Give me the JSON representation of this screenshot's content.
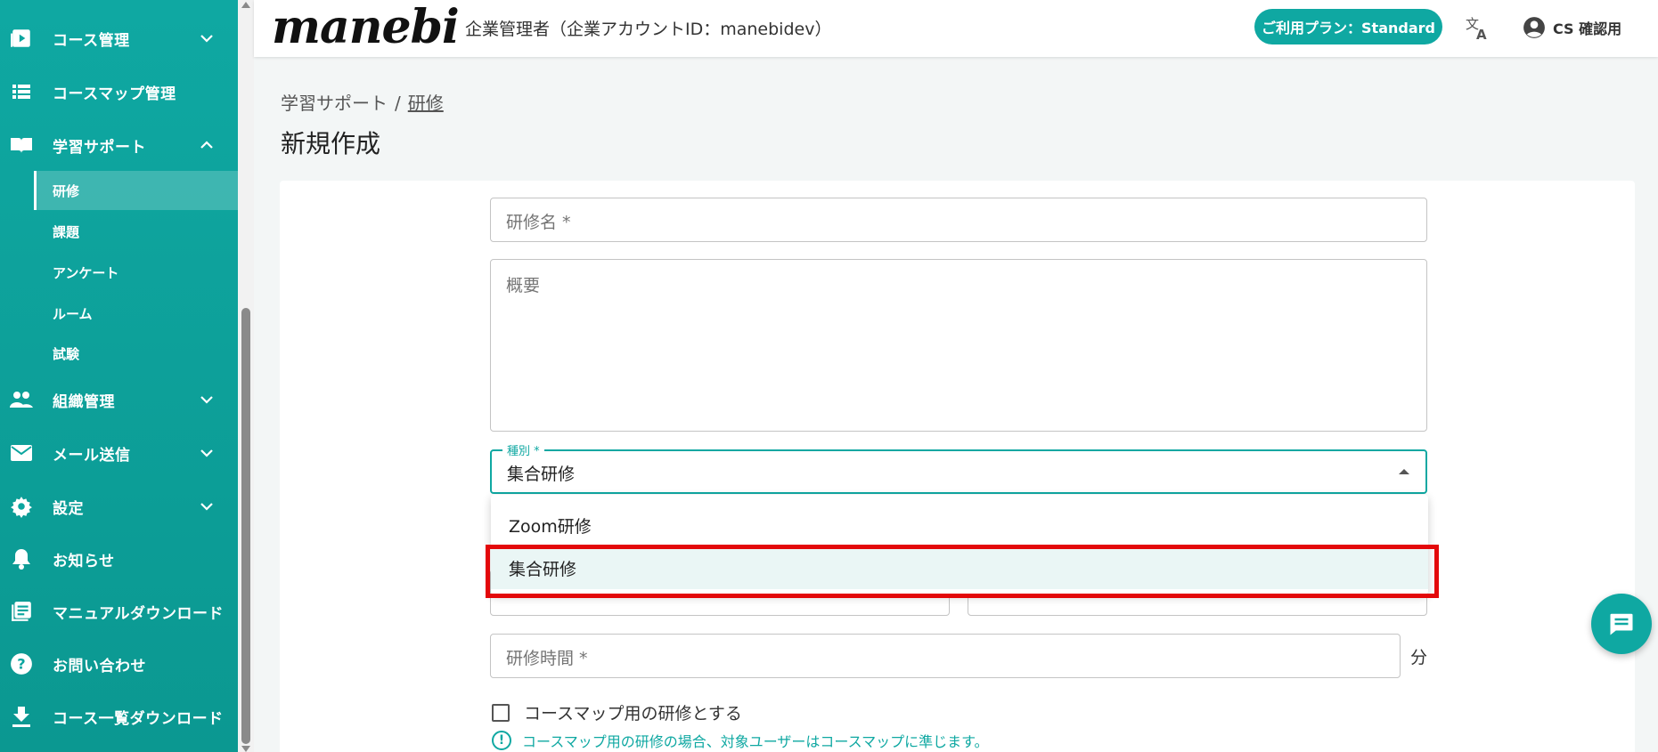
{
  "sidebar": {
    "items": [
      {
        "label": "コース管理",
        "icon": "play-square-icon",
        "expandable": true
      },
      {
        "label": "コースマップ管理",
        "icon": "list-icon",
        "expandable": false
      },
      {
        "label": "学習サポート",
        "icon": "book-icon",
        "expandable": true,
        "expanded": true
      },
      {
        "label": "組織管理",
        "icon": "people-icon",
        "expandable": true
      },
      {
        "label": "メール送信",
        "icon": "mail-icon",
        "expandable": true
      },
      {
        "label": "設定",
        "icon": "gear-icon",
        "expandable": true
      },
      {
        "label": "お知らせ",
        "icon": "bell-icon",
        "expandable": false
      },
      {
        "label": "マニュアルダウンロード",
        "icon": "document-icon",
        "expandable": false
      },
      {
        "label": "お問い合わせ",
        "icon": "help-icon",
        "expandable": false
      },
      {
        "label": "コース一覧ダウンロード",
        "icon": "download-icon",
        "expandable": false
      }
    ],
    "subitems": [
      {
        "label": "研修",
        "active": true
      },
      {
        "label": "課題"
      },
      {
        "label": "アンケート"
      },
      {
        "label": "ルーム"
      },
      {
        "label": "試験"
      }
    ]
  },
  "header": {
    "logo": "manebi",
    "account": "企業管理者（企業アカウントID：manebidev）",
    "plan": "ご利用プラン：Standard",
    "user": "CS 確認用"
  },
  "breadcrumb": {
    "parent": "学習サポート",
    "sep": "/",
    "current": "研修"
  },
  "page_title": "新規作成",
  "form": {
    "name_placeholder": "研修名 *",
    "summary_placeholder": "概要",
    "type_label": "種別 *",
    "type_value": "集合研修",
    "type_options": [
      "Zoom研修",
      "集合研修"
    ],
    "duration_placeholder": "研修時間 *",
    "duration_unit": "分",
    "coursemap_checkbox": "コースマップ用の研修とする",
    "coursemap_hint": "コースマップ用の研修の場合、対象ユーザーはコースマップに準じます。"
  },
  "colors": {
    "brand": "#0fa8a2",
    "highlight": "#e3080a"
  }
}
